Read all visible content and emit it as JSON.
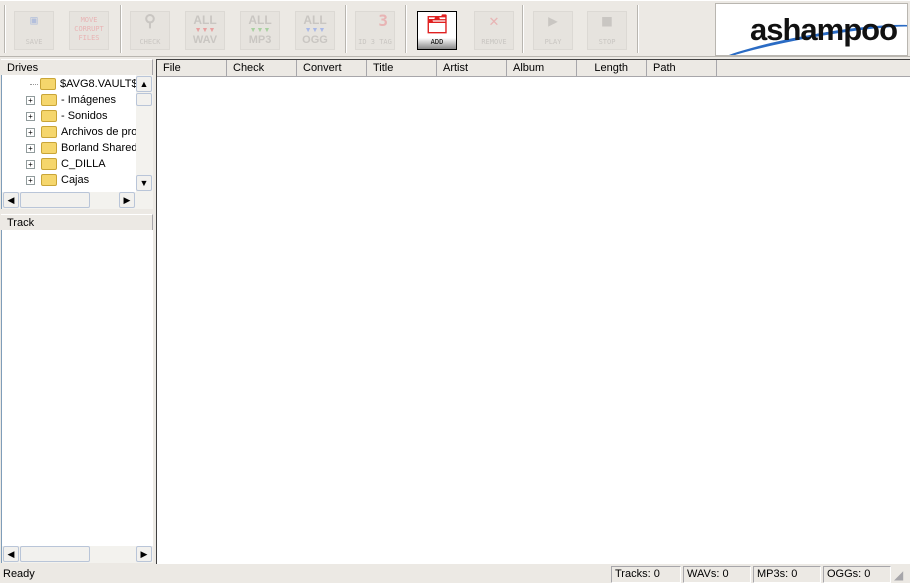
{
  "toolbar": {
    "buttons": [
      {
        "id": "save",
        "label": "SAVE",
        "icon": "floppy-icon",
        "enabled": false
      },
      {
        "id": "move",
        "label": "MOVE CORRUPT FILES",
        "icon": "",
        "enabled": false
      },
      {
        "id": "check",
        "label": "CHECK",
        "icon": "magnifier-icon",
        "enabled": false
      },
      {
        "id": "wav",
        "label": "WAV",
        "top": "ALL",
        "icon": "wav-icon",
        "enabled": false
      },
      {
        "id": "mp3",
        "label": "MP3",
        "top": "ALL",
        "icon": "mp3-icon",
        "enabled": false
      },
      {
        "id": "ogg",
        "label": "OGG",
        "top": "ALL",
        "icon": "ogg-icon",
        "enabled": false
      },
      {
        "id": "id3",
        "label": "ID 3 TAG",
        "icon": "id3-icon",
        "enabled": false
      },
      {
        "id": "add",
        "label": "ADD",
        "icon": "add-files-icon",
        "enabled": true
      },
      {
        "id": "remove",
        "label": "REMOVE",
        "icon": "remove-icon",
        "enabled": false
      },
      {
        "id": "play",
        "label": "PLAY",
        "icon": "play-icon",
        "enabled": false
      },
      {
        "id": "stop",
        "label": "STOP",
        "icon": "stop-icon",
        "enabled": false
      }
    ],
    "logo": "ashampoo"
  },
  "drives": {
    "header": "Drives",
    "items": [
      "$AVG8.VAULT$",
      "- Imágenes",
      "- Sonidos",
      "Archivos de pro",
      "Borland Shared",
      "C_DILLA",
      "Cajas"
    ]
  },
  "track": {
    "header": "Track"
  },
  "list": {
    "columns": [
      "File",
      "Check",
      "Convert",
      "Title",
      "Artist",
      "Album",
      "Length",
      "Path"
    ]
  },
  "status": {
    "text": "Ready",
    "tracks": "Tracks: 0",
    "wavs": "WAVs: 0",
    "mp3s": "MP3s: 0",
    "oggs": "OGGs: 0"
  }
}
